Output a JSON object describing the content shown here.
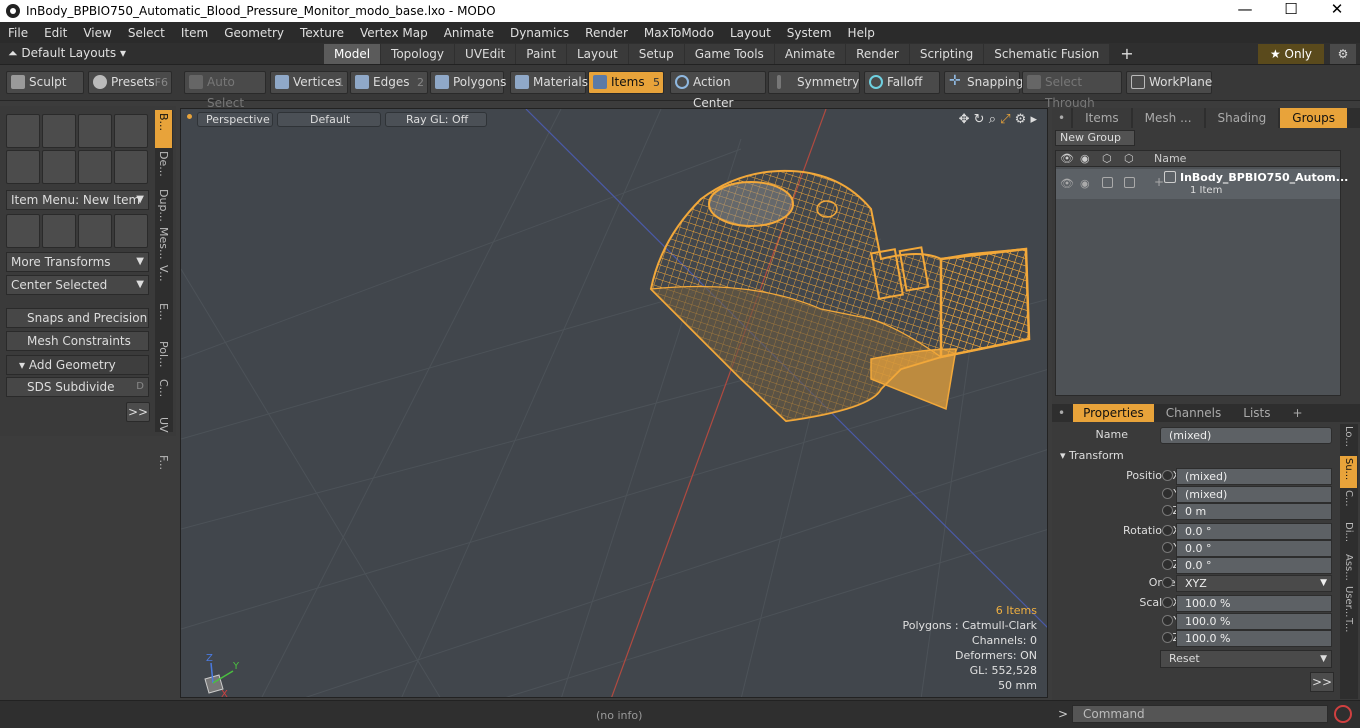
{
  "window": {
    "title": "InBody_BPBIO750_Automatic_Blood_Pressure_Monitor_modo_base.lxo - MODO"
  },
  "menu": [
    "File",
    "Edit",
    "View",
    "Select",
    "Item",
    "Geometry",
    "Texture",
    "Vertex Map",
    "Animate",
    "Dynamics",
    "Render",
    "MaxToModo",
    "Layout",
    "System",
    "Help"
  ],
  "layout": {
    "dropdown": "Default Layouts ▾",
    "tabs": [
      "Model",
      "Topology",
      "UVEdit",
      "Paint",
      "Layout",
      "Setup",
      "Game Tools",
      "Animate",
      "Render",
      "Scripting",
      "Schematic Fusion"
    ],
    "active_tab": "Model",
    "plus": "+",
    "only": "★ Only"
  },
  "toolbar": {
    "sculpt": "Sculpt",
    "presets": "Presets",
    "presets_key": "F6",
    "auto_select": "Auto Select",
    "vertices": "Vertices",
    "vertices_key": "1",
    "edges": "Edges",
    "edges_key": "2",
    "polygons": "Polygons",
    "materials": "Materials",
    "items": "Items",
    "items_key": "5",
    "action_center": "Action Center",
    "symmetry": "Symmetry",
    "falloff": "Falloff",
    "snapping": "Snapping",
    "select_through": "Select Through",
    "workplane": "WorkPlane"
  },
  "leftpanel": {
    "item_menu": "Item Menu: New Item",
    "more_transforms": "More Transforms",
    "center_selected": "Center Selected",
    "snaps": "Snaps and Precision",
    "mesh_constraints": "Mesh Constraints",
    "add_geometry": "Add Geometry",
    "sds": "SDS Subdivide",
    "sds_key": "D",
    "more": ">>",
    "vtabs": [
      "B...",
      "De...",
      "Dup...",
      "Mes...",
      "V...",
      "E...",
      "Pol...",
      "C...",
      "UV",
      "F..."
    ]
  },
  "viewport": {
    "view": "Perspective",
    "style": "Default",
    "raygl": "Ray GL: Off",
    "info": {
      "items": "6 Items",
      "polygons": "Polygons : Catmull-Clark",
      "channels": "Channels: 0",
      "deformers": "Deformers: ON",
      "gl": "GL: 552,528",
      "scale": "50 mm"
    },
    "axis": {
      "x": "X",
      "y": "Y",
      "z": "Z"
    }
  },
  "groups": {
    "tabs": [
      "Items",
      "Mesh ...",
      "Shading",
      "Groups"
    ],
    "active": "Groups",
    "new_group": "New Group",
    "col_name": "Name",
    "row_name": "InBody_BPBIO750_Autom...",
    "row_sub": "1 Item"
  },
  "properties": {
    "tabs": [
      "Properties",
      "Channels",
      "Lists"
    ],
    "plus": "+",
    "name_label": "Name",
    "name_value": "(mixed)",
    "transform": "Transform",
    "rows": [
      {
        "label": "Position X",
        "value": "(mixed)"
      },
      {
        "label": "Y",
        "value": "(mixed)"
      },
      {
        "label": "Z",
        "value": "0 m"
      },
      {
        "label": "Rotation X",
        "value": "0.0 °"
      },
      {
        "label": "Y",
        "value": "0.0 °"
      },
      {
        "label": "Z",
        "value": "0.0 °"
      },
      {
        "label": "Order",
        "value": "XYZ"
      },
      {
        "label": "Scale X",
        "value": "100.0 %"
      },
      {
        "label": "Y",
        "value": "100.0 %"
      },
      {
        "label": "Z",
        "value": "100.0 %"
      }
    ],
    "reset": "Reset",
    "more": ">>",
    "sidetabs": [
      "Lo...",
      "Su...",
      "C...",
      "Di...",
      "Ass...",
      "User...",
      "T..."
    ]
  },
  "status": {
    "noinfo": "(no info)",
    "command_placeholder": "Command",
    "prompt": ">"
  },
  "colors": {
    "accent": "#e8a33a",
    "wire": "#f2a83a"
  }
}
